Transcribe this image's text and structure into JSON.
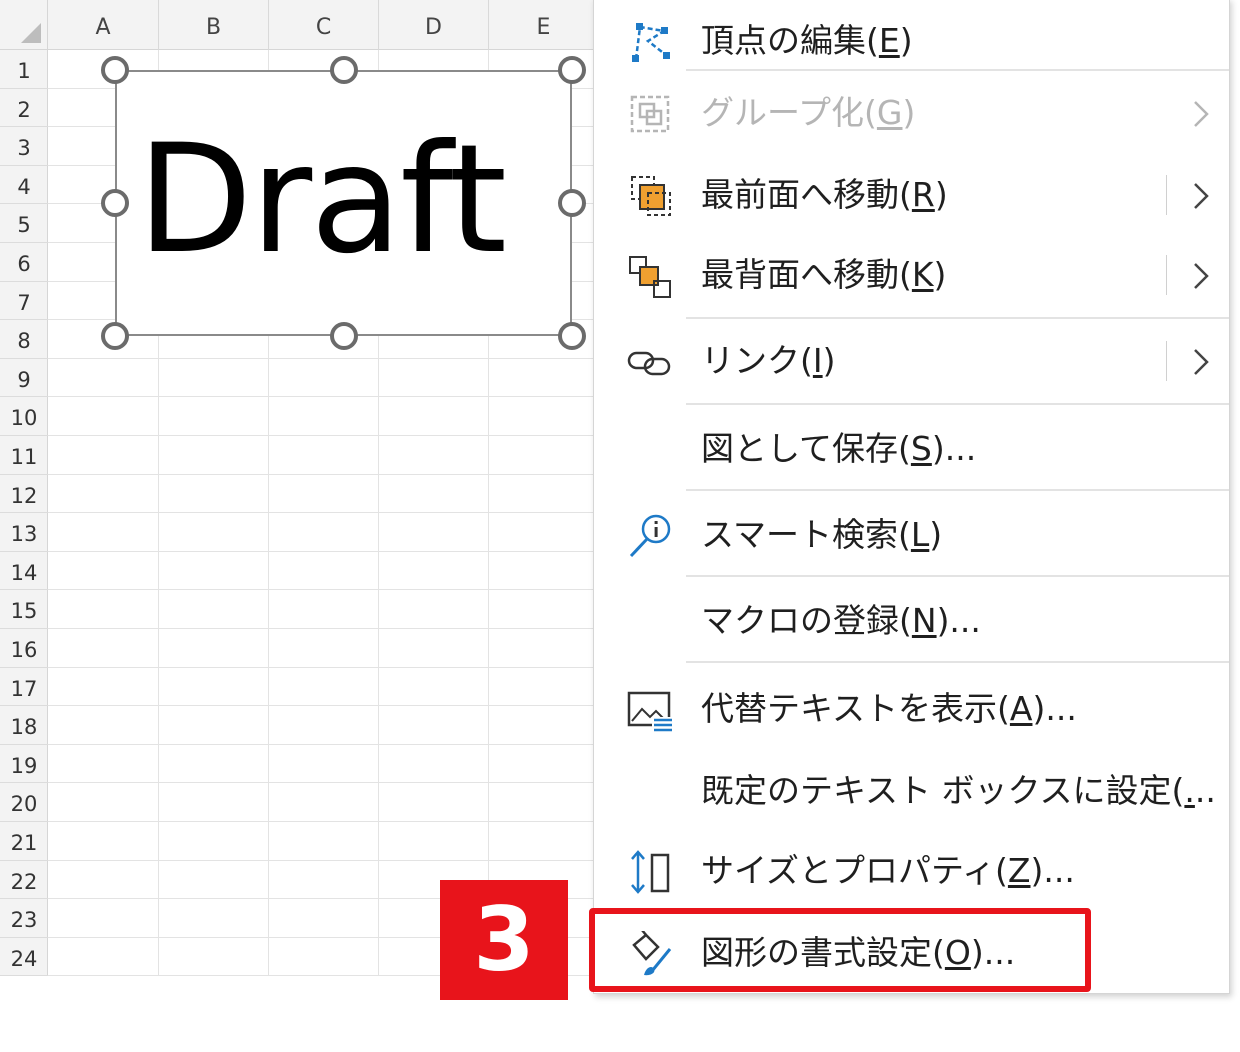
{
  "sheet": {
    "columns": [
      "A",
      "B",
      "C",
      "D",
      "E"
    ],
    "rows": [
      "1",
      "2",
      "3",
      "4",
      "5",
      "6",
      "7",
      "8",
      "9",
      "10",
      "11",
      "12",
      "13",
      "14",
      "15",
      "16",
      "17",
      "18",
      "19",
      "20",
      "21",
      "22",
      "23",
      "24"
    ],
    "textbox": {
      "text": "Draft"
    }
  },
  "menu": {
    "items": [
      {
        "label": "頂点の編集(",
        "key": "E",
        "suffix": ")",
        "icon": "edit-points-icon",
        "enabled": true,
        "submenu": false
      },
      {
        "label": "グループ化(",
        "key": "G",
        "suffix": ")",
        "icon": "group-icon",
        "enabled": false,
        "submenu": true
      },
      {
        "label": "最前面へ移動(",
        "key": "R",
        "suffix": ")",
        "icon": "bring-to-front-icon",
        "enabled": true,
        "submenu": true
      },
      {
        "label": "最背面へ移動(",
        "key": "K",
        "suffix": ")",
        "icon": "send-to-back-icon",
        "enabled": true,
        "submenu": true
      },
      {
        "label": "リンク(",
        "key": "I",
        "suffix": ")",
        "icon": "link-icon",
        "enabled": true,
        "submenu": true
      },
      {
        "label": "図として保存(",
        "key": "S",
        "suffix": ")...",
        "icon": "",
        "enabled": true,
        "submenu": false
      },
      {
        "label": "スマート検索(",
        "key": "L",
        "suffix": ")",
        "icon": "smart-lookup-icon",
        "enabled": true,
        "submenu": false
      },
      {
        "label": "マクロの登録(",
        "key": "N",
        "suffix": ")...",
        "icon": "",
        "enabled": true,
        "submenu": false
      },
      {
        "label": "代替テキストを表示(",
        "key": "A",
        "suffix": ")...",
        "icon": "alt-text-icon",
        "enabled": true,
        "submenu": false
      },
      {
        "label": "既定のテキスト ボックスに設定(",
        "key": ".",
        "suffix": "..",
        "icon": "",
        "enabled": true,
        "submenu": false
      },
      {
        "label": "サイズとプロパティ(",
        "key": "Z",
        "suffix": ")...",
        "icon": "size-properties-icon",
        "enabled": true,
        "submenu": false
      },
      {
        "label": "図形の書式設定(",
        "key": "O",
        "suffix": ")...",
        "icon": "format-shape-icon",
        "enabled": true,
        "submenu": false
      }
    ]
  },
  "annotation": {
    "step": "3",
    "color": "#e8141b"
  },
  "colors": {
    "accent_blue": "#1e7ac7",
    "accent_orange": "#f0a030"
  }
}
